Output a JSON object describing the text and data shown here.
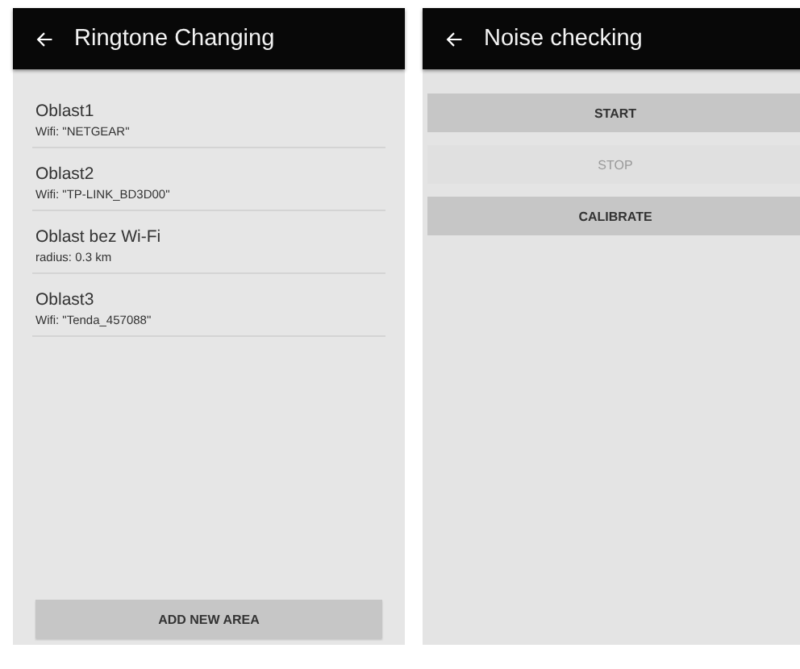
{
  "screens": [
    {
      "title": "Ringtone Changing",
      "kind": "list",
      "items": [
        {
          "name": "Oblast1",
          "detail": "Wifi: \"NETGEAR\""
        },
        {
          "name": "Oblast2",
          "detail": "Wifi: \"TP-LINK_BD3D00\""
        },
        {
          "name": "Oblast bez Wi-Fi",
          "detail": "radius: 0.3 km"
        },
        {
          "name": "Oblast3",
          "detail": "Wifi: \"Tenda_457088\""
        }
      ],
      "footer_button": "ADD NEW AREA"
    },
    {
      "title": "Noise checking",
      "kind": "buttons",
      "buttons": [
        {
          "label": "START",
          "disabled": false
        },
        {
          "label": "STOP",
          "disabled": true
        },
        {
          "label": "CALIBRATE",
          "disabled": false
        }
      ]
    }
  ]
}
